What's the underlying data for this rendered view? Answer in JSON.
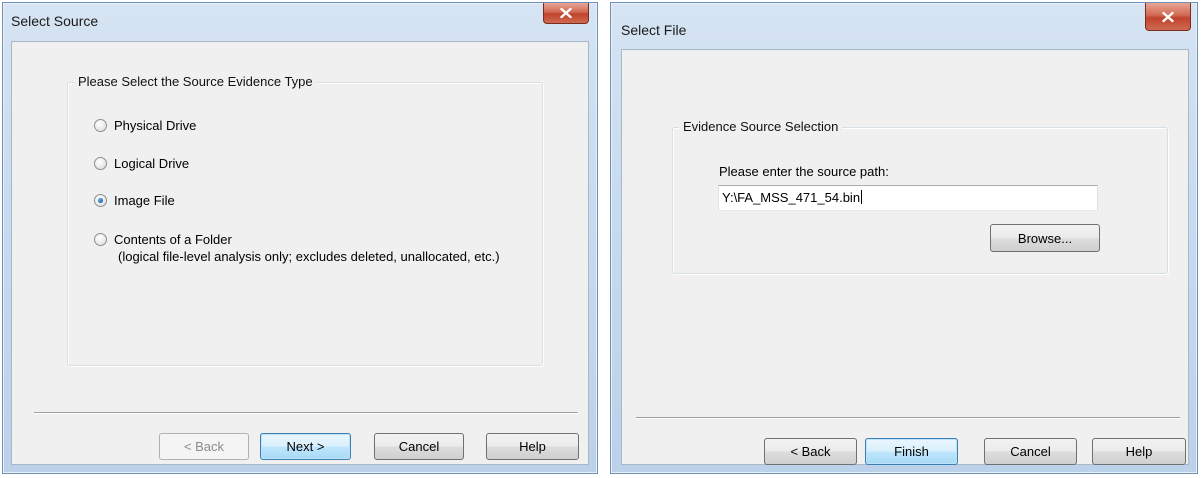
{
  "left_dialog": {
    "title": "Select Source",
    "group_label": "Please Select the Source Evidence Type",
    "options": [
      {
        "label": "Physical Drive",
        "checked": false
      },
      {
        "label": "Logical Drive",
        "checked": false
      },
      {
        "label": "Image File",
        "checked": true
      },
      {
        "label": "Contents of a Folder",
        "sublabel": "(logical file-level analysis only; excludes deleted, unallocated, etc.)",
        "checked": false
      }
    ],
    "buttons": {
      "back": "< Back",
      "next": "Next >",
      "cancel": "Cancel",
      "help": "Help"
    }
  },
  "right_dialog": {
    "title": "Select File",
    "group_label": "Evidence Source Selection",
    "path_prompt": "Please enter the source path:",
    "path_value": "Y:\\FA_MSS_471_54.bin",
    "browse": "Browse...",
    "buttons": {
      "back": "< Back",
      "finish": "Finish",
      "cancel": "Cancel",
      "help": "Help"
    }
  },
  "icons": {
    "close": "close-icon",
    "radio": "radio-button"
  },
  "colors": {
    "close_button": "#c7442c",
    "default_button_border": "#3c7fb1",
    "frame": "#bcd1ea",
    "client": "#f0f0f0"
  }
}
